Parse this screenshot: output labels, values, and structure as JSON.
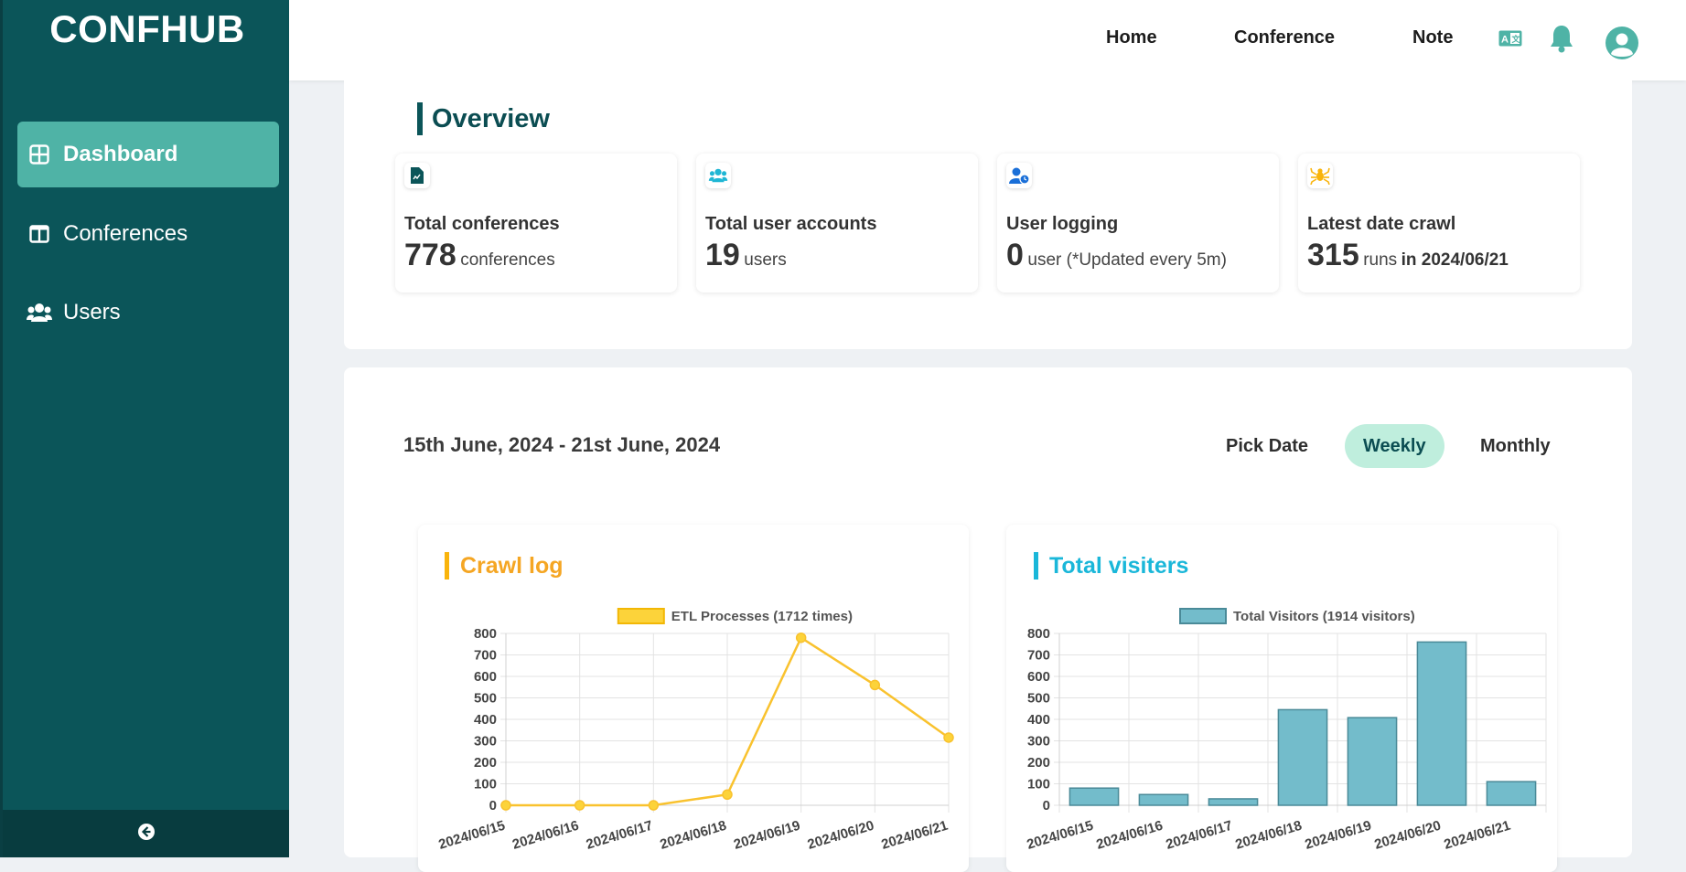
{
  "sidebar": {
    "brand": "CONFHUB",
    "items": [
      {
        "label": "Dashboard",
        "icon": "dashboard-grid-icon",
        "active": true
      },
      {
        "label": "Conferences",
        "icon": "columns-icon",
        "active": false
      },
      {
        "label": "Users",
        "icon": "users-icon",
        "active": false
      }
    ],
    "collapse_icon": "arrow-left-circle-icon"
  },
  "header": {
    "nav": [
      "Home",
      "Conference",
      "Note"
    ],
    "icons": [
      "translate-icon",
      "bell-icon",
      "user-avatar-icon"
    ]
  },
  "overview": {
    "title": "Overview",
    "stats": [
      {
        "icon": "file-chart-icon",
        "label": "Total conferences",
        "value": "778",
        "unit": "conferences",
        "extra": ""
      },
      {
        "icon": "users-icon",
        "label": "Total user accounts",
        "value": "19",
        "unit": "users",
        "extra": ""
      },
      {
        "icon": "user-clock-icon",
        "label": "User logging",
        "value": "0",
        "unit": "user (*Updated every 5m)",
        "extra": ""
      },
      {
        "icon": "spider-icon",
        "label": "Latest date crawl",
        "value": "315",
        "unit": "runs",
        "extra": "in 2024/06/21"
      }
    ]
  },
  "filter": {
    "date_range": "15th June, 2024 - 21st June, 2024",
    "tabs": [
      "Pick Date",
      "Weekly",
      "Monthly"
    ],
    "active_tab": "Weekly"
  },
  "colors": {
    "sidebar": "#0b5559",
    "active": "#4fb3a6",
    "crawl": "#f9c22e",
    "visitors": "#73bccb"
  },
  "chart_data": [
    {
      "type": "line",
      "title": "Crawl log",
      "categories": [
        "2024/06/15",
        "2024/06/16",
        "2024/06/17",
        "2024/06/18",
        "2024/06/19",
        "2024/06/20",
        "2024/06/21"
      ],
      "series": [
        {
          "name": "ETL Processes (1712 times)",
          "values": [
            0,
            0,
            0,
            50,
            780,
            560,
            315
          ]
        }
      ],
      "yticks": [
        "800",
        "700",
        "600",
        "500",
        "400",
        "300",
        "200",
        "100",
        "0"
      ],
      "ylim": [
        0,
        800
      ],
      "grid": true,
      "legend": "top"
    },
    {
      "type": "bar",
      "title": "Total visiters",
      "categories": [
        "2024/06/15",
        "2024/06/16",
        "2024/06/17",
        "2024/06/18",
        "2024/06/19",
        "2024/06/20",
        "2024/06/21"
      ],
      "series": [
        {
          "name": "Total Visitors (1914 visitors)",
          "values": [
            80,
            50,
            30,
            445,
            408,
            760,
            110
          ]
        }
      ],
      "yticks": [
        "800",
        "700",
        "600",
        "500",
        "400",
        "300",
        "200",
        "100",
        "0"
      ],
      "ylim": [
        0,
        800
      ],
      "grid": true,
      "legend": "top"
    }
  ]
}
